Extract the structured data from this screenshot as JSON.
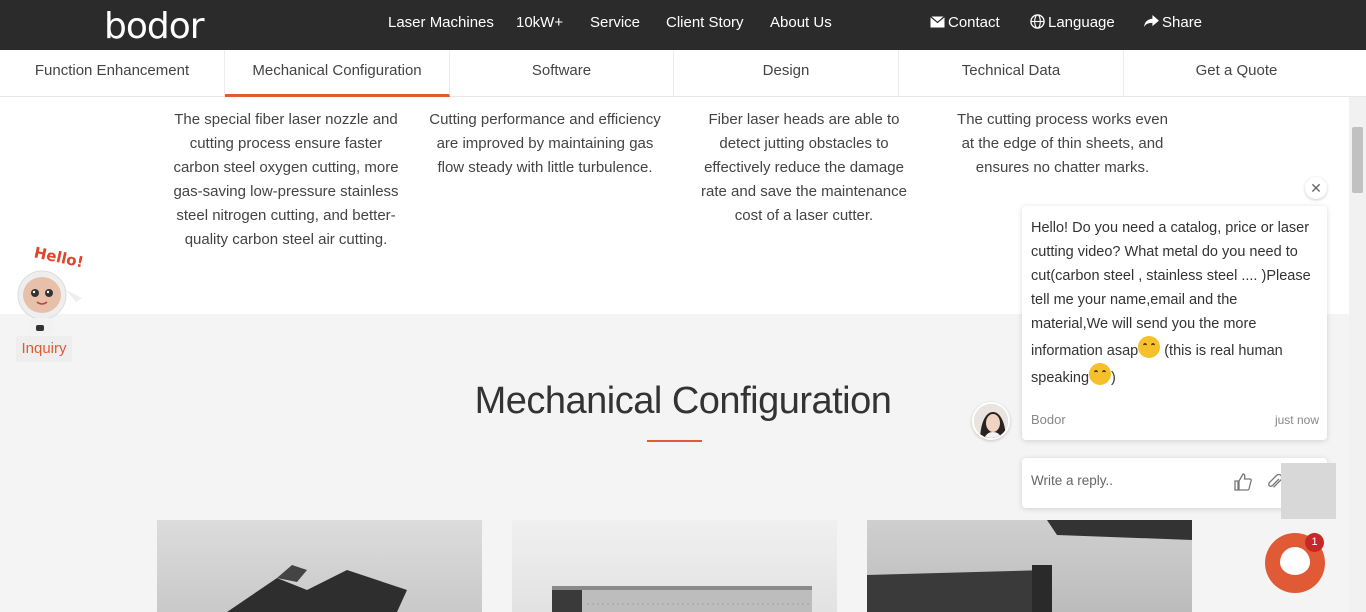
{
  "header": {
    "logo": "bodor",
    "nav": [
      "Laser Machines",
      "10kW+",
      "Service",
      "Client Story",
      "About Us"
    ],
    "actions": [
      "Contact",
      "Language",
      "Share"
    ]
  },
  "subtabs": [
    "Function Enhancement",
    "Mechanical Configuration",
    "Software",
    "Design",
    "Technical Data",
    "Get a Quote"
  ],
  "active_subtab": "Mechanical Configuration",
  "features": [
    "The special fiber laser nozzle and cutting process ensure faster carbon steel oxygen cutting, more gas-saving low-pressure stainless steel nitrogen cutting, and better-quality carbon steel air cutting.",
    "Cutting performance and efficiency are improved by maintaining gas flow steady with little turbulence.",
    "Fiber laser heads are able to detect jutting obstacles to effectively reduce the damage rate and save the maintenance cost of a laser cutter.",
    "The cutting process works even at the edge of thin sheets, and ensures no chatter marks."
  ],
  "section": {
    "title": "Mechanical Configuration"
  },
  "mascot": {
    "greeting": "Hello!",
    "label": "Inquiry"
  },
  "chat": {
    "message_part1": "Hello! Do you need a catalog, price or laser cutting video? What metal do you need to cut(carbon steel , stainless steel .... )Please tell me your name,email and the material,We will send you the more information asap",
    "message_part2": "  (this is real human speaking",
    "message_part3": ")",
    "sender": "Bodor",
    "time": "just now",
    "reply_placeholder": "Write a reply..",
    "close_symbol": "✕",
    "unread_count": "1"
  },
  "colors": {
    "accent": "#e05a35",
    "topbar": "#2b2b2b",
    "section_bg": "#f4f4f4"
  },
  "icons": [
    "envelope-icon",
    "globe-icon",
    "share-icon",
    "thumbs-up-icon",
    "paperclip-icon",
    "smiley-icon",
    "close-icon",
    "chat-icon"
  ]
}
